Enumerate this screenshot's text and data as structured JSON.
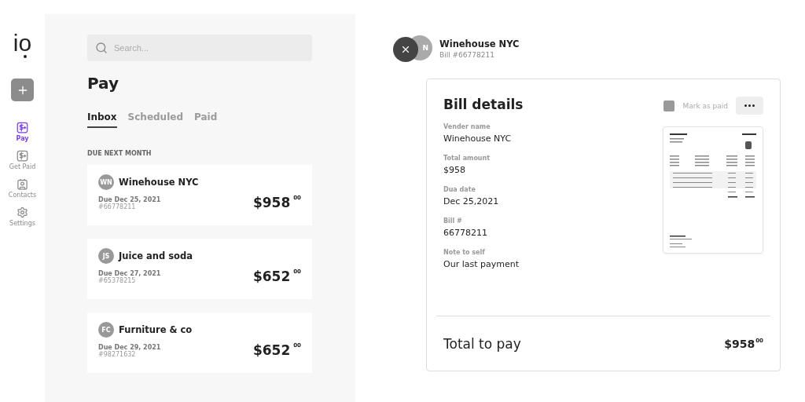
{
  "sidebar": {
    "logo": "io",
    "nav": [
      {
        "label": "Pay",
        "kind": "pay",
        "selected": true
      },
      {
        "label": "Get Paid",
        "kind": "getpaid",
        "selected": false
      },
      {
        "label": "Contacts",
        "kind": "contacts",
        "selected": false
      },
      {
        "label": "Settings",
        "kind": "settings",
        "selected": false
      }
    ]
  },
  "list": {
    "search": {
      "placeholder": "Search..."
    },
    "title": "Pay",
    "tabs": [
      {
        "label": "Inbox",
        "selected": true
      },
      {
        "label": "Scheduled",
        "selected": false
      },
      {
        "label": "Paid",
        "selected": false
      }
    ],
    "section": "DUE NEXT MONTH",
    "bills": [
      {
        "initials": "WN",
        "vendor": "Winehouse NYC",
        "due": "Due Dec 25, 2021",
        "number": "#66778211",
        "amount": "$958",
        "cents": "00"
      },
      {
        "initials": "JS",
        "vendor": "Juice and soda",
        "due": "Due Dec 27, 2021",
        "number": "#65378215",
        "amount": "$652",
        "cents": "00"
      },
      {
        "initials": "FC",
        "vendor": "Furniture & co",
        "due": "Due Dec 29, 2021",
        "number": "#98271632",
        "amount": "$652",
        "cents": "00"
      }
    ]
  },
  "detail": {
    "avatar_initials": "N",
    "vendor": "Winehouse NYC",
    "bill": "Bill #66778211",
    "title": "Bill details",
    "mark_as_paid": {
      "label": "Mark as paid",
      "checked": false
    },
    "fields": [
      {
        "label": "Vender name",
        "value": "Winehouse NYC"
      },
      {
        "label": "Total amount",
        "value": "$958"
      },
      {
        "label": "Dua date",
        "value": "Dec 25,2021"
      },
      {
        "label": "Bill #",
        "value": "66778211"
      },
      {
        "label": "Note to self",
        "value": "Our last payment"
      }
    ],
    "total_label": "Total to pay",
    "total_amount": "$958",
    "total_cents": "00"
  }
}
